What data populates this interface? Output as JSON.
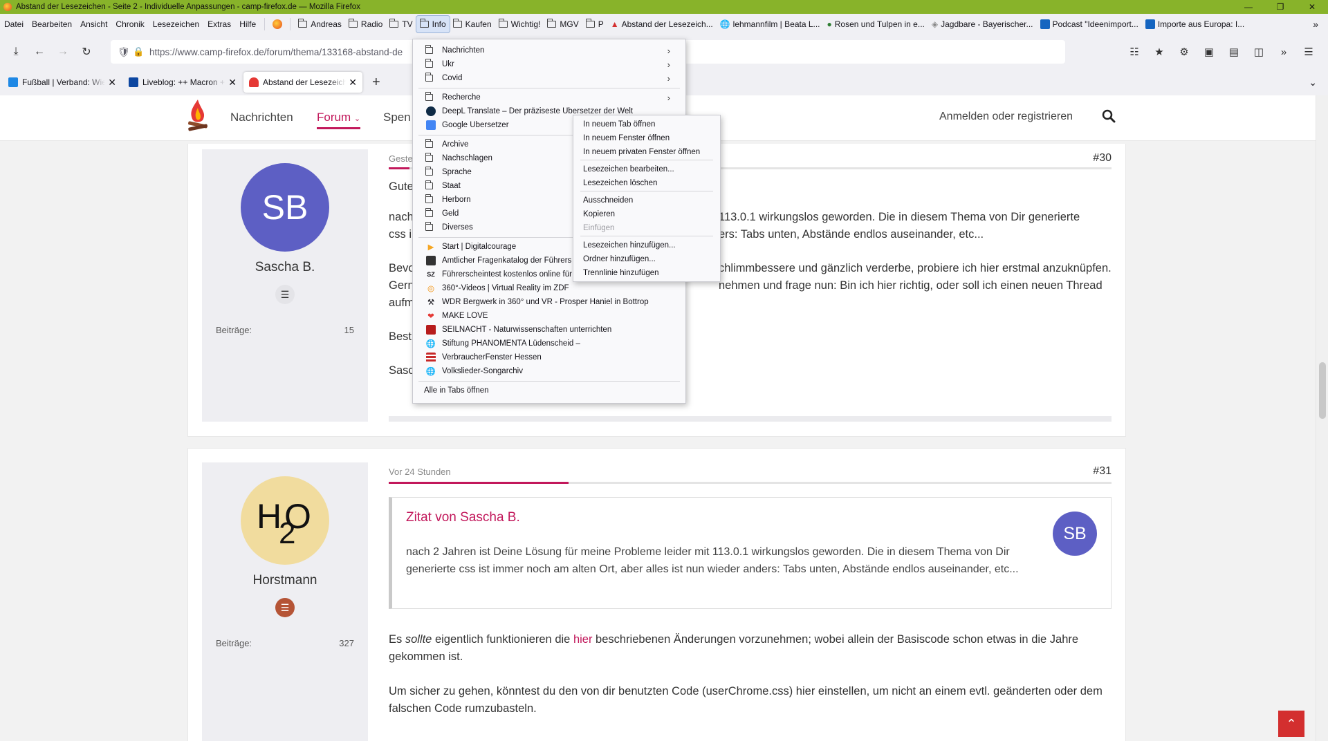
{
  "window": {
    "title": "Abstand der Lesezeichen - Seite 2 - Individuelle Anpassungen - camp-firefox.de — Mozilla Firefox"
  },
  "menubar": {
    "items": [
      "Datei",
      "Bearbeiten",
      "Ansicht",
      "Chronik",
      "Lesezeichen",
      "Extras",
      "Hilfe"
    ]
  },
  "bookmarks_bar": {
    "items": [
      "Andreas",
      "Radio",
      "TV",
      "Info",
      "Kaufen",
      "Wichtig!",
      "MGV",
      "P",
      "Abstand der Lesezeich...",
      "lehmannfilm | Beata L...",
      "Rosen und Tulpen in e...",
      "Jagdbare - Bayerischer...",
      "Podcast \"Ideenimport...",
      "Importe aus Europa: I..."
    ]
  },
  "urlbar": {
    "url": "https://www.camp-firefox.de/forum/thema/133168-abstand-de"
  },
  "tabs": [
    {
      "title": "Fußball | Verband: Wie"
    },
    {
      "title": "Liveblog: ++ Macron ++"
    },
    {
      "title": "Abstand der Lesezeich"
    }
  ],
  "site": {
    "nav": {
      "news": "Nachrichten",
      "forum": "Forum",
      "donate": "Spen"
    },
    "login": "Anmelden oder registrieren"
  },
  "post1": {
    "avatar_initials": "SB",
    "username": "Sascha B.",
    "stat_label": "Beiträge:",
    "stat_value": "15",
    "meta": "Geste",
    "number": "#30",
    "lines": [
      "Gute",
      "nach",
      "113.0.1 wirkungslos geworden. Die in diesem Thema von Dir generierte",
      "css i",
      "ers: Tabs unten, Abstände endlos auseinander, etc...",
      "Bevo",
      "chlimmbessere und gänzlich verderbe, probiere ich hier erstmal anzuknüpfen.",
      "Gern",
      "nehmen und frage nun: Bin ich hier richtig, oder soll ich einen neuen Thread",
      "aufm",
      "Best",
      "Sasc"
    ]
  },
  "post2": {
    "username": "Horstmann",
    "stat_label": "Beiträge:",
    "stat_value": "327",
    "meta": "Vor 24 Stunden",
    "number": "#31",
    "quote_title": "Zitat von Sascha B.",
    "quote_avatar": "SB",
    "quote_text": "nach 2 Jahren ist Deine Lösung für meine Probleme leider mit 113.0.1 wirkungslos geworden. Die in diesem Thema von Dir generierte css ist immer noch am alten Ort, aber alles ist nun wieder anders: Tabs unten, Abstände endlos auseinander, etc...",
    "p1_before": "Es ",
    "p1_em": "sollte",
    "p1_mid": " eigentlich funktionieren die ",
    "p1_link": "hier",
    "p1_after": " beschriebenen Änderungen vorzunehmen; wobei allein der Basiscode schon etwas in die Jahre gekommen ist.",
    "p2": "Um sicher zu gehen, könntest du den von dir benutzten Code (userChrome.css) hier einstellen, um nicht an einem evtl. geänderten oder dem falschen Code rumzubasteln."
  },
  "dropdown": {
    "folders_top": [
      "Nachrichten",
      "Ukr",
      "Covid"
    ],
    "recherche": "Recherche",
    "deepl": "DeepL Translate – Der präziseste Übersetzer der Welt",
    "google": "Google Übersetzer",
    "folders_mid": [
      "Archive",
      "Nachschlagen",
      "Sprache",
      "Staat",
      "Herborn",
      "Geld",
      "Diverses"
    ],
    "links": [
      "Start | Digitalcourage",
      "Amtlicher Fragenkatalog der Führers",
      "Führerscheintest kostenlos online für",
      "360°-Videos | Virtual Reality im ZDF",
      "WDR Bergwerk in 360° und VR - Prosper Haniel in Bottrop",
      "MAKE LOVE",
      "SEILNACHT - Naturwissenschaften unterrichten",
      "Stiftung PHÄNOMENTA Lüdenscheid –",
      "VerbraucherFenster  Hessen",
      "Volkslieder-Songarchiv"
    ],
    "open_all": "Alle in Tabs öffnen"
  },
  "context_menu": {
    "open_tab": "In neuem Tab öffnen",
    "open_window": "In neuem Fenster öffnen",
    "open_private": "In neuem privaten Fenster öffnen",
    "edit": "Lesezeichen bearbeiten...",
    "delete": "Lesezeichen löschen",
    "cut": "Ausschneiden",
    "copy": "Kopieren",
    "paste": "Einfügen",
    "add_bookmark": "Lesezeichen hinzufügen...",
    "add_folder": "Ordner hinzufügen...",
    "add_separator": "Trennlinie hinzufügen"
  },
  "colors": {
    "accent": "#c2185b",
    "titlebar": "#88b32a",
    "avatar_sb": "#5d5fc4",
    "avatar_h2o": "#f1dc9e"
  }
}
